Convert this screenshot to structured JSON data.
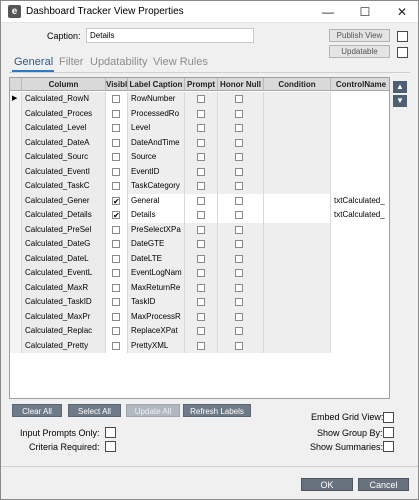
{
  "window": {
    "title": "Dashboard Tracker View Properties",
    "minimize": "—",
    "maximize": "☐",
    "close": "✕"
  },
  "caption": {
    "label": "Caption:",
    "value": "Details",
    "publish_label": "Publish View",
    "updatable_label": "Updatable"
  },
  "tabs": [
    "General",
    "Filter",
    "Updatability",
    "View Rules"
  ],
  "grid": {
    "columns": [
      "Column",
      "Visibl",
      "Label Caption",
      "Prompt",
      "Honor Null",
      "Condition",
      "ControlName"
    ],
    "rows": [
      {
        "column": "Calculated_RowN",
        "visible": false,
        "label": "RowNumber",
        "control": "",
        "current": true
      },
      {
        "column": "Calculated_Proces",
        "visible": false,
        "label": "ProcessedRo",
        "control": ""
      },
      {
        "column": "Calculated_Level",
        "visible": false,
        "label": "Level",
        "control": ""
      },
      {
        "column": "Calculated_DateA",
        "visible": false,
        "label": "DateAndTime",
        "control": ""
      },
      {
        "column": "Calculated_Sourc",
        "visible": false,
        "label": "Source",
        "control": ""
      },
      {
        "column": "Calculated_EventI",
        "visible": false,
        "label": "EventID",
        "control": ""
      },
      {
        "column": "Calculated_TaskC",
        "visible": false,
        "label": "TaskCategory",
        "control": ""
      },
      {
        "column": "Calculated_Gener",
        "visible": true,
        "label": "General",
        "control": "txtCalculated_"
      },
      {
        "column": "Calculated_Details",
        "visible": true,
        "label": "Details",
        "control": "txtCalculated_"
      },
      {
        "column": "Calculated_PreSel",
        "visible": false,
        "label": "PreSelectXPa",
        "control": ""
      },
      {
        "column": "Calculated_DateG",
        "visible": false,
        "label": "DateGTE",
        "control": ""
      },
      {
        "column": "Calculated_DateL",
        "visible": false,
        "label": "DateLTE",
        "control": ""
      },
      {
        "column": "Calculated_EventL",
        "visible": false,
        "label": "EventLogNam",
        "control": ""
      },
      {
        "column": "Calculated_MaxR",
        "visible": false,
        "label": "MaxReturnRe",
        "control": ""
      },
      {
        "column": "Calculated_TaskID",
        "visible": false,
        "label": "TaskID",
        "control": ""
      },
      {
        "column": "Calculated_MaxPr",
        "visible": false,
        "label": "MaxProcessR",
        "control": ""
      },
      {
        "column": "Calculated_Replac",
        "visible": false,
        "label": "ReplaceXPat",
        "control": ""
      },
      {
        "column": "Calculated_Pretty",
        "visible": false,
        "label": "PrettyXML",
        "control": ""
      }
    ]
  },
  "grid_buttons": {
    "clear_all": "Clear All",
    "select_all": "Select All",
    "update_all": "Update All",
    "refresh_labels": "Refresh Labels"
  },
  "options": {
    "embed_grid_view": "Embed Grid View:",
    "input_prompts_only": "Input Prompts Only:",
    "show_group_by": "Show Group By:",
    "criteria_required": "Criteria Required:",
    "show_summaries": "Show Summaries:"
  },
  "dialog": {
    "ok": "OK",
    "cancel": "Cancel"
  }
}
